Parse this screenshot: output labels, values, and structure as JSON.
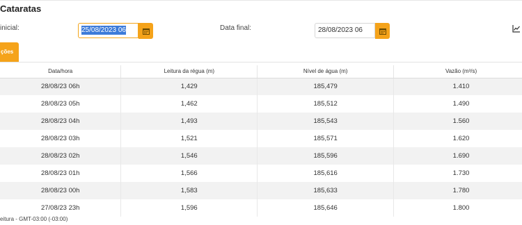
{
  "header": {
    "title": "Cataratas"
  },
  "filters": {
    "start_label": "inicial:",
    "start_value": "25/08/2023 06",
    "end_label": "Data final:",
    "end_value": "28/08/2023 06"
  },
  "tabs": [
    {
      "label": "ções",
      "active": true
    }
  ],
  "table": {
    "headers": [
      "Data/hora",
      "Leitura da régua (m)",
      "Nível de água (m)",
      "Vazão (m³/s)"
    ],
    "rows": [
      [
        "28/08/23 06h",
        "1,429",
        "185,479",
        "1.410"
      ],
      [
        "28/08/23 05h",
        "1,462",
        "185,512",
        "1.490"
      ],
      [
        "28/08/23 04h",
        "1,493",
        "185,543",
        "1.560"
      ],
      [
        "28/08/23 03h",
        "1,521",
        "185,571",
        "1.620"
      ],
      [
        "28/08/23 02h",
        "1,546",
        "185,596",
        "1.690"
      ],
      [
        "28/08/23 01h",
        "1,566",
        "185,616",
        "1.730"
      ],
      [
        "28/08/23 00h",
        "1,583",
        "185,633",
        "1.780"
      ],
      [
        "27/08/23 23h",
        "1,596",
        "185,646",
        "1.800"
      ]
    ]
  },
  "footnote": "eitura - GMT-03:00 (-03:00)",
  "colors": {
    "accent": "#f5a31a",
    "selection": "#3d7bd9",
    "row_alt": "#f2f2f2"
  },
  "icons": [
    "calendar-icon",
    "line-chart-icon"
  ]
}
